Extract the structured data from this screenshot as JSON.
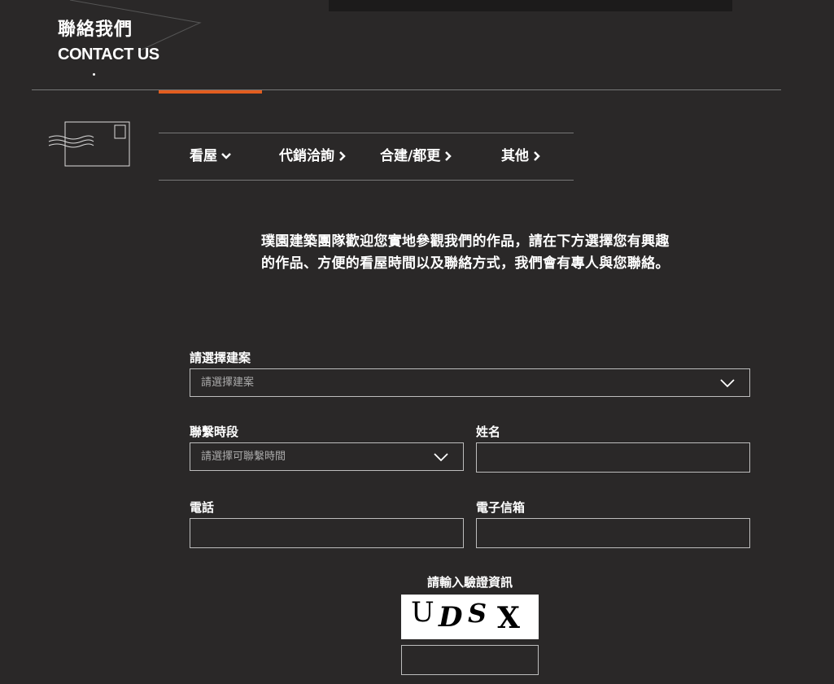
{
  "header": {
    "title_zh": "聯絡我們",
    "title_en": "CONTACT US"
  },
  "tabs": [
    {
      "label": "看屋",
      "arrow": "⌄",
      "active": true
    },
    {
      "label": "代銷洽詢",
      "arrow": "›"
    },
    {
      "label": "合建/都更",
      "arrow": "›"
    },
    {
      "label": "其他",
      "arrow": "›"
    }
  ],
  "colors": {
    "accent": "#e25d1f",
    "background": "#2a2828"
  },
  "intro": "璞園建築團隊歡迎您實地參觀我們的作品，請在下方選擇您有興趣的作品、方便的看屋時間以及聯絡方式，我們會有專人與您聯絡。",
  "form": {
    "project_label": "請選擇建案",
    "project_value": "請選擇建案",
    "time_label": "聯繫時段",
    "time_value": "請選擇可聯繫時間",
    "name_label": "姓名",
    "name_value": "",
    "phone_label": "電話",
    "phone_value": "",
    "email_label": "電子信箱",
    "email_value": "",
    "captcha_label": "請輸入驗證資訊",
    "captcha_chars": [
      "U",
      "D",
      "S",
      "X"
    ],
    "captcha_value": ""
  }
}
